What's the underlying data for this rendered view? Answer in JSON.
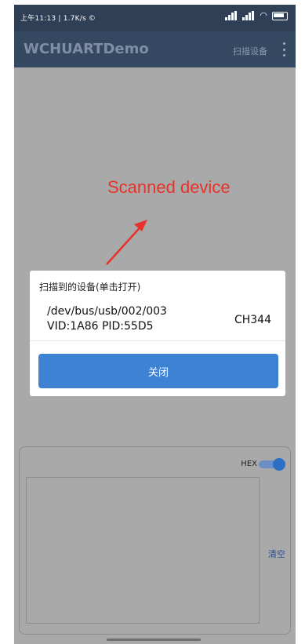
{
  "status_bar": {
    "time_text": "上午11:13 | 1.7K/s ©"
  },
  "app_bar": {
    "title": "WCHUARTDemo",
    "scan_action": "扫描设备"
  },
  "annotation": {
    "text": "Scanned device",
    "color": "#e8312a"
  },
  "dialog": {
    "title": "扫描到的设备(单击打开)",
    "devices": [
      {
        "path": "/dev/bus/usb/002/003",
        "ids": "VID:1A86 PID:55D5",
        "chip": "CH344"
      }
    ],
    "close_button": "关闭"
  },
  "bottom_panel": {
    "hex_label": "HEX",
    "hex_enabled": true,
    "clear_button": "清空"
  },
  "colors": {
    "primary_dark": "#2f3f55",
    "button_blue": "#3e82d4",
    "overlay": "#a9a9a9"
  },
  "icons": [
    "signal-icon",
    "wifi-icon",
    "battery-icon",
    "overflow-menu-icon"
  ]
}
